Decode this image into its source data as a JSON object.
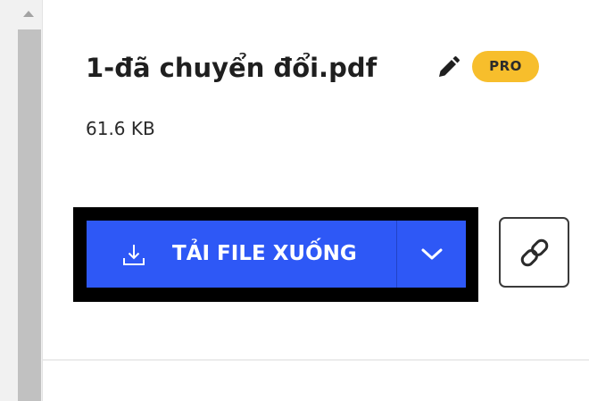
{
  "file": {
    "name": "1-đã chuyển đổi.pdf",
    "size": "61.6 KB",
    "badge": "PRO"
  },
  "actions": {
    "download_label": "TẢI FILE XUỐNG"
  },
  "icons": {
    "edit": "pencil-icon",
    "download": "download-icon",
    "dropdown": "chevron-down-icon",
    "copy_link": "link-icon",
    "scroll_up": "scroll-up-arrow-icon"
  },
  "colors": {
    "primary": "#2e58f6",
    "badge": "#f7be2c",
    "highlight_frame": "#000000"
  }
}
